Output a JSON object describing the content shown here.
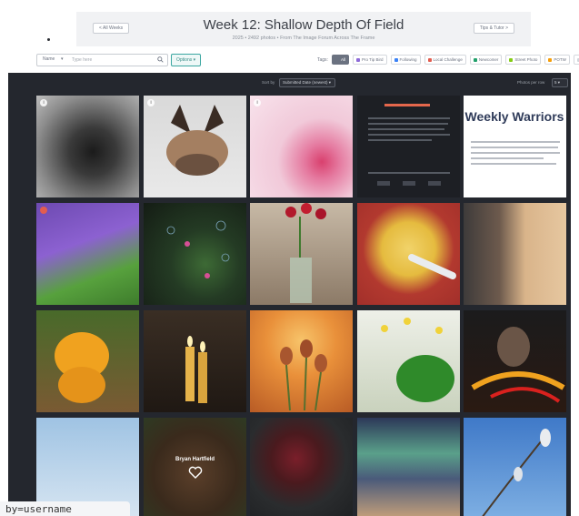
{
  "header": {
    "back_label": "< All Weeks",
    "title": "Week 12: Shallow Depth Of Field",
    "subtitle": "2025 • 2492 photos • From The Image Forum Across The Frame",
    "tips_label": "Tips & Tutor >"
  },
  "filter": {
    "scope": "Name",
    "search_placeholder": "Type here",
    "options_label": "Options ▾",
    "tags_label": "Tags:",
    "tags": [
      {
        "label": "All",
        "color": "#6b7280",
        "active": true
      },
      {
        "label": "Pro Tip Bird",
        "color": "#8e6bd8",
        "active": false
      },
      {
        "label": "Following",
        "color": "#3b82f6",
        "active": false
      },
      {
        "label": "Local Challenge",
        "color": "#e25d4f",
        "active": false
      },
      {
        "label": "Newcomer",
        "color": "#22a06b",
        "active": false
      },
      {
        "label": "Street Photo",
        "color": "#84cc16",
        "active": false
      },
      {
        "label": "POTW",
        "color": "#f59e0b",
        "active": false
      },
      {
        "label": "Fav",
        "color": "#d1d5db",
        "active": false
      }
    ]
  },
  "gallery": {
    "sort_label": "Sort by",
    "sort_value": "Submitted Date (newest) ▾",
    "per_row_label": "Photos per row",
    "per_row_value": "5 ▾",
    "overlay_name": "Bryan Hartfield",
    "weekly_logo": "Weekly Warriors"
  },
  "status_url": "by=username"
}
